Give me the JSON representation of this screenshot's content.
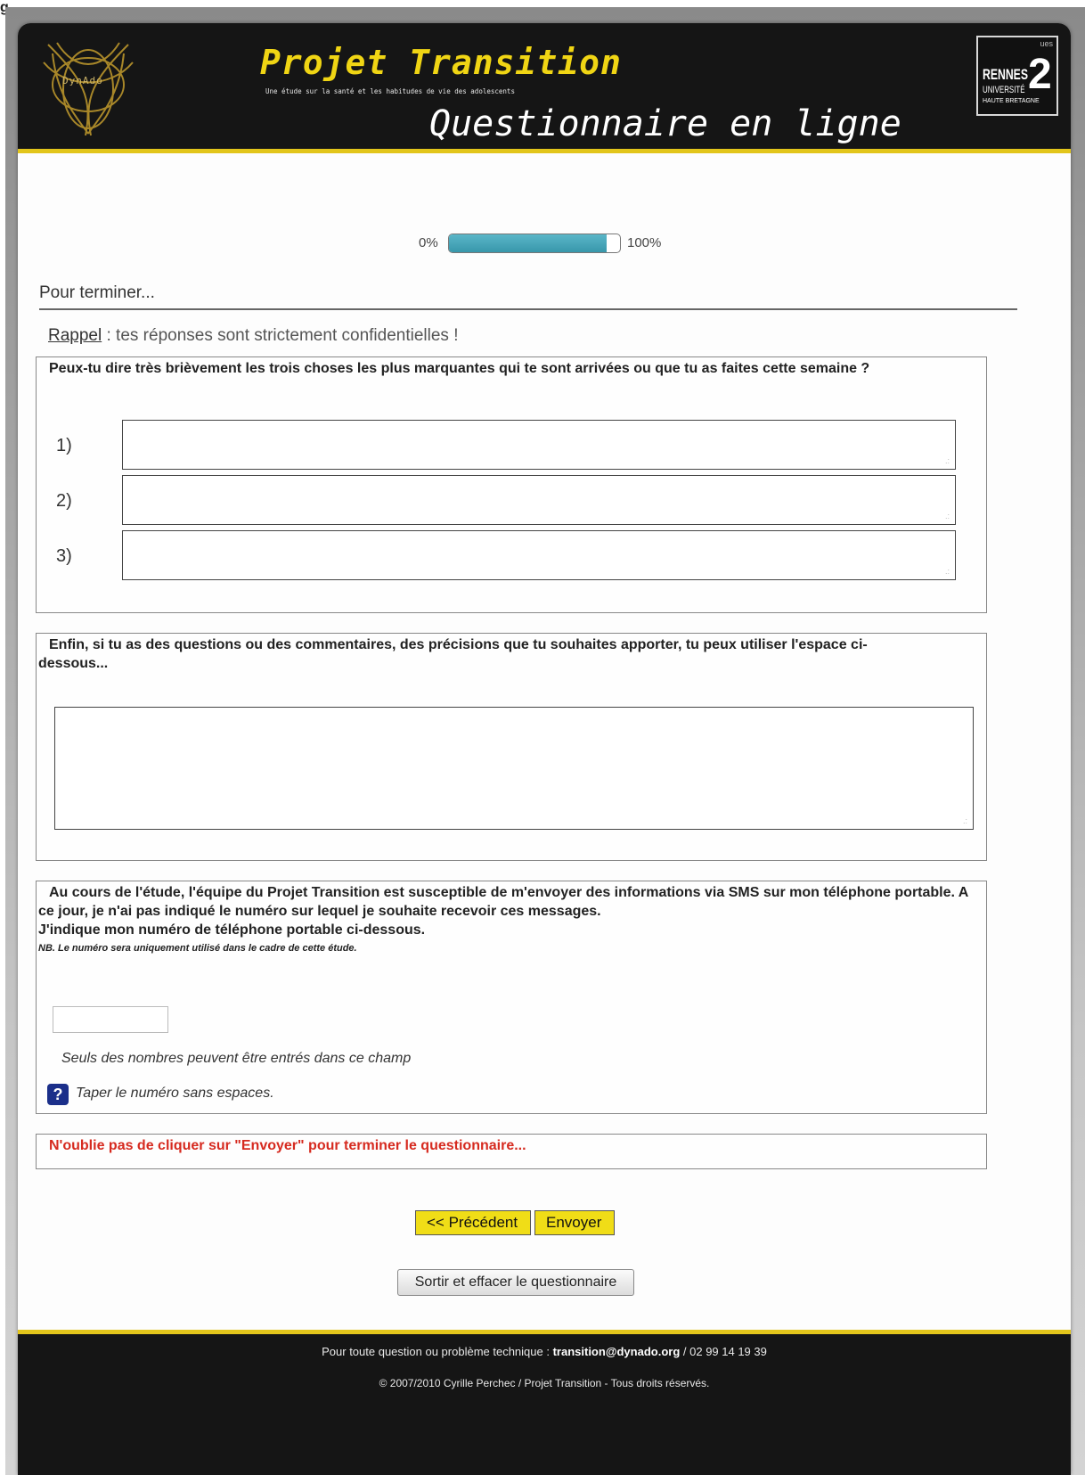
{
  "figure_label": "g",
  "header": {
    "logo_text": "DynAdo",
    "title": "Projet Transition",
    "subtitle": "Une étude sur la santé et les habitudes de vie des adolescents",
    "questionnaire_title": "Questionnaire en ligne",
    "university": {
      "small": "ues",
      "rennes": "RENNES",
      "number": "2",
      "line2": "UNIVERSITÉ",
      "line3": "HAUTE BRETAGNE"
    }
  },
  "progress": {
    "min_label": "0%",
    "max_label": "100%",
    "fraction": 0.92
  },
  "section_title": "Pour terminer...",
  "reminder": {
    "label": "Rappel",
    "text": " : tes réponses sont strictement confidentielles !"
  },
  "question1": {
    "text": "Peux-tu dire très brièvement les trois choses les plus marquantes qui te sont arrivées ou que tu as faites cette semaine ?",
    "items": [
      {
        "number": "1)",
        "value": ""
      },
      {
        "number": "2)",
        "value": ""
      },
      {
        "number": "3)",
        "value": ""
      }
    ]
  },
  "question2": {
    "text": "Enfin, si tu as des questions ou des commentaires, des précisions que tu souhaites apporter, tu peux utiliser l'espace ci-dessous...",
    "value": ""
  },
  "question3": {
    "line1": "Au cours de l'étude, l'équipe du Projet Transition est susceptible de m'envoyer des informations via SMS sur mon téléphone portable. A ce jour, je n'ai pas indiqué le numéro sur lequel je souhaite recevoir ces messages.",
    "line2": "J'indique mon numéro de téléphone portable ci-dessous.",
    "note": "NB. Le numéro sera uniquement utilisé dans le cadre de cette étude.",
    "value": "",
    "hint": "Seuls des nombres peuvent être entrés dans ce champ",
    "help": "Taper le numéro sans espaces."
  },
  "warning": "N'oublie pas de cliquer sur \"Envoyer\" pour terminer le questionnaire...",
  "buttons": {
    "previous": "<< Précédent",
    "submit": "Envoyer",
    "quit": "Sortir et effacer le questionnaire"
  },
  "footer": {
    "contact_prefix": "Pour toute question ou problème technique : ",
    "email": "transition@dynado.org",
    "phone": " / 02 99 14 19 39",
    "copyright": "© 2007/2010 Cyrille Perchec / Projet Transition - Tous droits réservés."
  },
  "colors": {
    "header_bg": "#151515",
    "accent_yellow": "#e2c51b",
    "progress_fill": "#3897ab",
    "warning_red": "#d62a1f",
    "help_icon_blue": "#1b2f8a"
  }
}
